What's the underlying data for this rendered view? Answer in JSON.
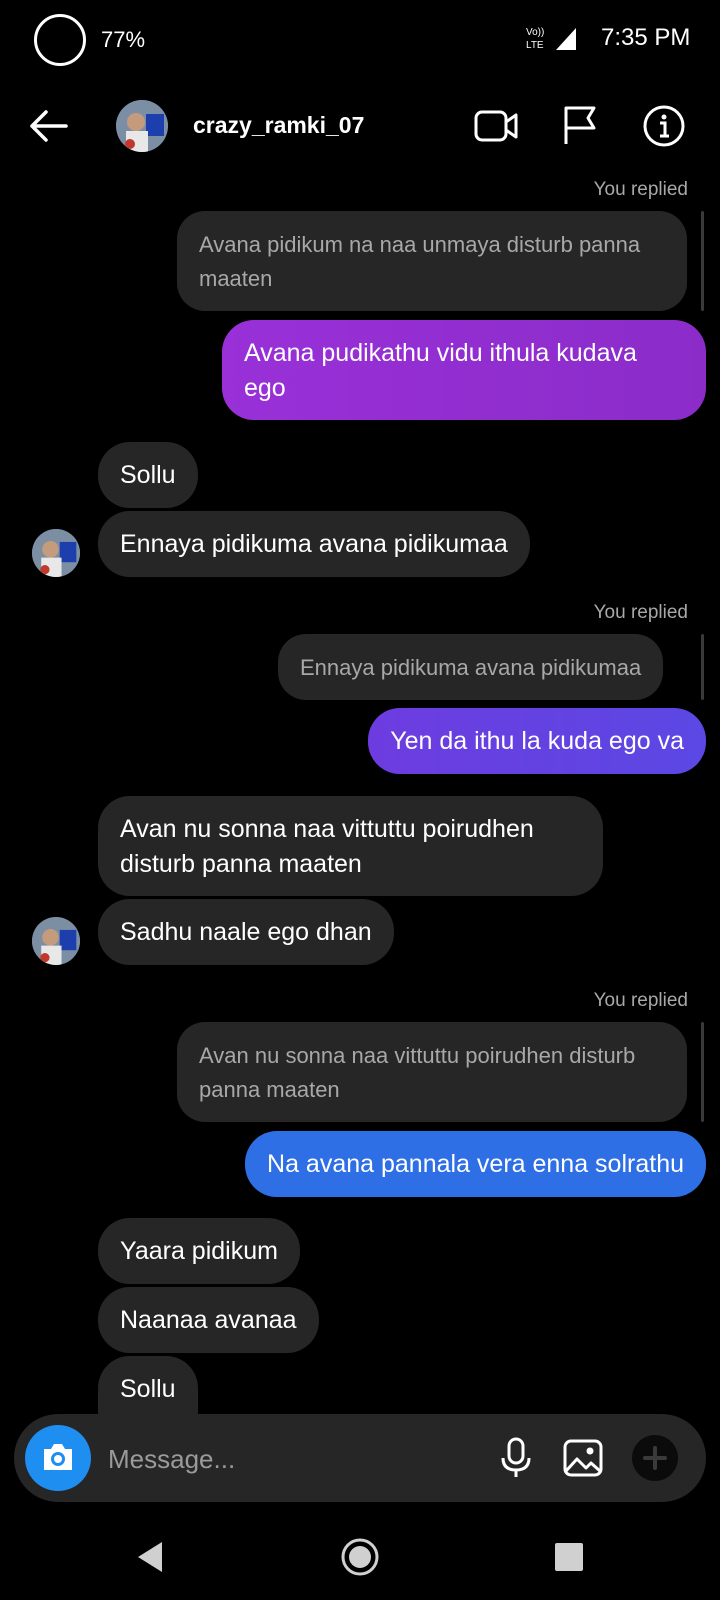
{
  "status_bar": {
    "battery": "77%",
    "network": "Vo)) LTE",
    "time": "7:35 PM"
  },
  "header": {
    "username": "crazy_ramki_07"
  },
  "messages": [
    {
      "replied_label": "You replied",
      "quote": "Avana pidikum na naa unmaya disturb panna maaten",
      "text": "Avana pudikathu vidu ithula kudava ego"
    },
    {
      "text": "Sollu"
    },
    {
      "text": "Ennaya pidikuma avana pidikumaa"
    },
    {
      "replied_label": "You replied",
      "quote": "Ennaya pidikuma avana pidikumaa",
      "text": "Yen da ithu la kuda ego va"
    },
    {
      "text": "Avan nu sonna naa vittuttu poirudhen disturb panna maaten"
    },
    {
      "text": "Sadhu naale ego dhan"
    },
    {
      "replied_label": "You replied",
      "quote": "Avan nu sonna naa vittuttu poirudhen disturb panna maaten",
      "text": "Na avana pannala vera enna solrathu"
    },
    {
      "text": "Yaara pidikum"
    },
    {
      "text": "Naanaa avanaa"
    },
    {
      "text": "Sollu"
    }
  ],
  "composer": {
    "placeholder": "Message..."
  },
  "colors": {
    "out_1": "#8a2fd6",
    "out_2": "#6a3fe0",
    "out_3": "#2f6fe6",
    "incoming": "#262626",
    "camera": "#1f8ef1"
  }
}
